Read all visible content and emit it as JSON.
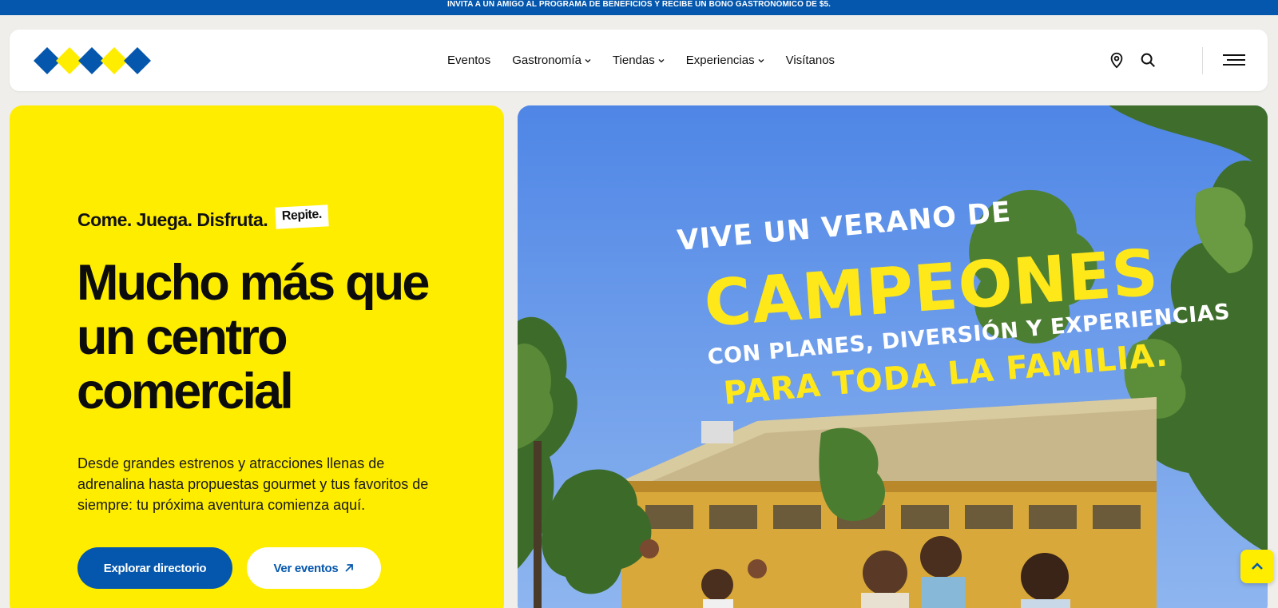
{
  "promo": {
    "text": "INVITA A UN AMIGO AL PROGRAMA DE BENEFICIOS Y RECIBE UN BONO GASTRONÓMICO DE $5."
  },
  "nav": {
    "items": [
      {
        "label": "Eventos",
        "has_dropdown": false
      },
      {
        "label": "Gastronomía",
        "has_dropdown": true
      },
      {
        "label": "Tiendas",
        "has_dropdown": true
      },
      {
        "label": "Experiencias",
        "has_dropdown": true
      },
      {
        "label": "Visítanos",
        "has_dropdown": false
      }
    ],
    "icons": [
      "location-pin-icon",
      "search-icon",
      "menu-icon"
    ]
  },
  "hero": {
    "tagline": "Come. Juega. Disfruta.",
    "tagline_badge": "Repite.",
    "headline": "Mucho más que un centro comercial",
    "description": "Desde grandes estrenos y atracciones llenas de adrenalina hasta propuestas gourmet y tus favoritos de siempre: tu próxima aventura comienza aquí.",
    "primary_button": "Explorar directorio",
    "secondary_button": "Ver eventos"
  },
  "banner": {
    "line1": "VIVE UN VERANO DE",
    "line2": "CAMPEONES",
    "line3": "CON PLANES, DIVERSIÓN Y EXPERIENCIAS",
    "line4": "PARA TODA LA FAMILIA."
  },
  "colors": {
    "brand_blue": "#0557ad",
    "brand_yellow": "#ffed00"
  }
}
